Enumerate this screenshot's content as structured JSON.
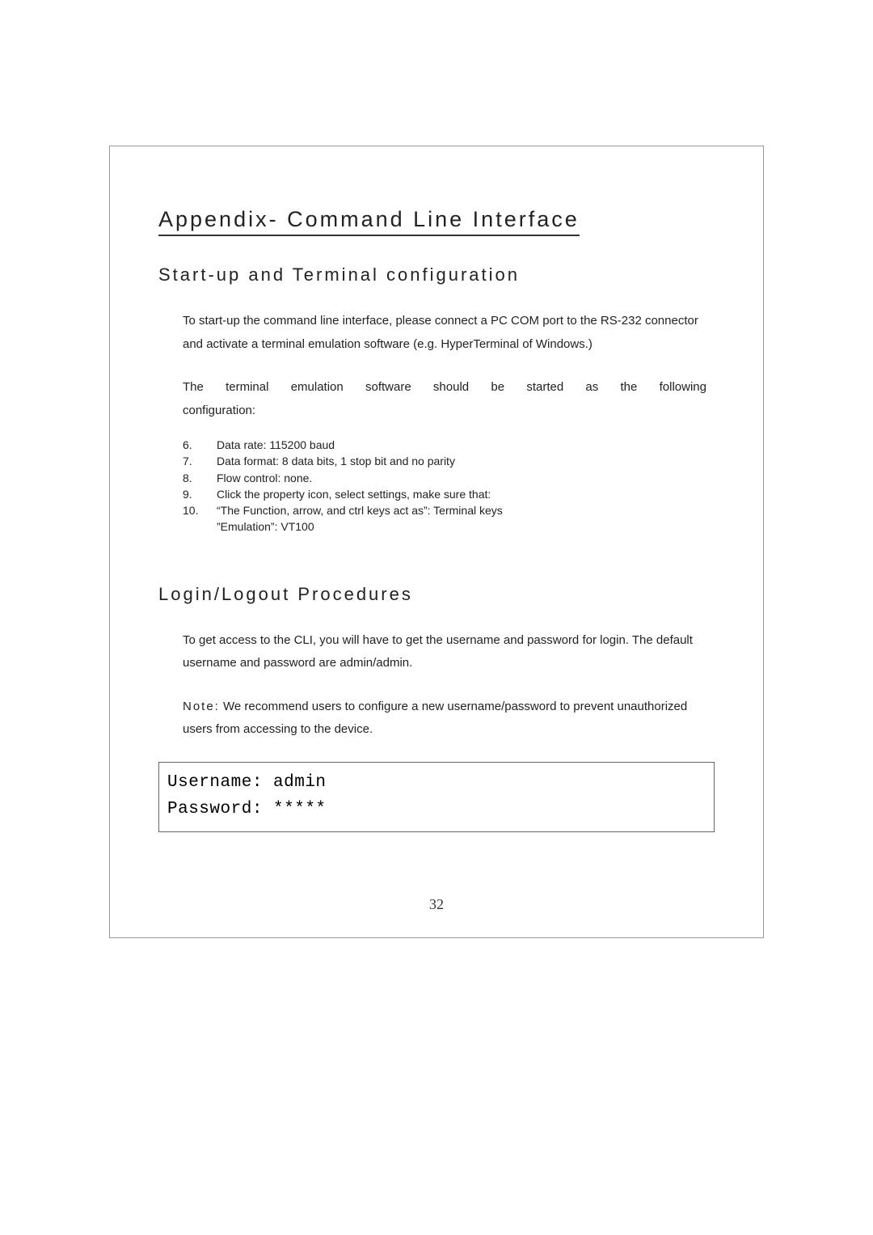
{
  "title": "Appendix- Command Line Interface",
  "section1": {
    "heading": "Start-up and Terminal configuration",
    "para1": "To start-up the command line interface, please connect a PC COM port to the RS-232 connector and activate a terminal emulation software (e.g. HyperTerminal of Windows.)",
    "para2a": "The terminal emulation software should be started as the following",
    "para2b": "configuration:",
    "list": [
      {
        "num": "6.",
        "text": "Data rate: 115200 baud"
      },
      {
        "num": "7.",
        "text": "Data format: 8 data bits, 1 stop bit and no parity"
      },
      {
        "num": "8.",
        "text": "Flow control: none."
      },
      {
        "num": "9.",
        "text": "Click the property icon, select settings, make sure that:"
      },
      {
        "num": "10.",
        "text": "“The Function, arrow, and ctrl keys act as”: Terminal keys"
      },
      {
        "num": "",
        "text": "”Emulation”: VT100"
      }
    ]
  },
  "section2": {
    "heading": "Login/Logout Procedures",
    "para1": "To get access to the CLI, you will have to get the username and password for login. The default username and password are admin/admin.",
    "note_label": "Note:",
    "note_text": " We recommend users to configure a new username/password to prevent unauthorized users from accessing to the device."
  },
  "terminal": {
    "line1": "Username: admin",
    "line2": "Password: *****"
  },
  "page_number": "32"
}
